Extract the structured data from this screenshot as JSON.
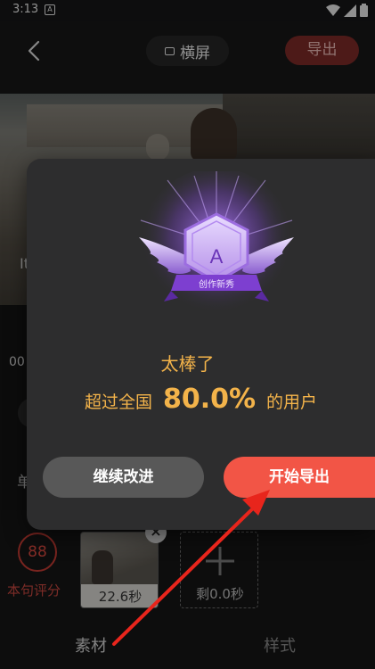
{
  "status_bar": {
    "time": "3:13",
    "notification_letter": "A"
  },
  "top_bar": {
    "orientation_label": "横屏",
    "export_label": "导出"
  },
  "preview": {
    "time_fragment": "00",
    "side_char": "单",
    "overlay_char": "It"
  },
  "bottom": {
    "score_value": "88",
    "score_label": "本句评分",
    "clip_duration": "22.6秒",
    "remaining": "剩0.0秒",
    "tab_material": "素材",
    "tab_style": "样式"
  },
  "modal": {
    "badge_letter": "A",
    "badge_ribbon": "创作新秀",
    "title": "太棒了",
    "stat_prefix": "超过全国",
    "stat_percent": "80.0%",
    "stat_suffix": "的用户",
    "improve_label": "继续改进",
    "export_label": "开始导出"
  },
  "icons": [
    "back-chevron-icon",
    "wifi-icon",
    "cellular-icon",
    "battery-icon",
    "plus-icon",
    "close-icon"
  ],
  "colors": {
    "accent": "#f25546",
    "highlight": "#f3b34a",
    "badge_purple": "#8b4fd1"
  }
}
